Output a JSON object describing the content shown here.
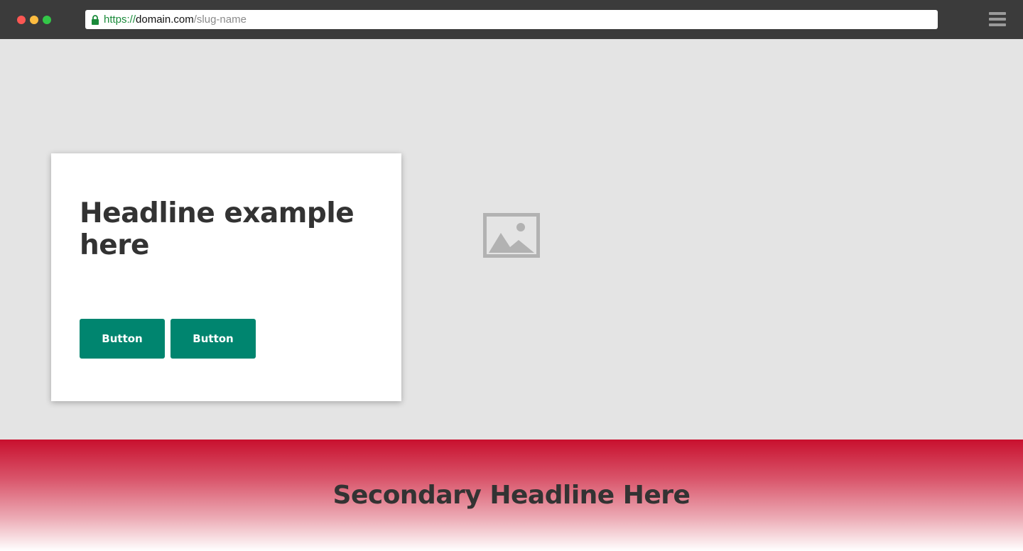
{
  "browser": {
    "window_controls": [
      "close",
      "minimize",
      "maximize"
    ],
    "url": {
      "scheme": "https://",
      "domain": "domain.com",
      "path": "/slug-name"
    },
    "icons": {
      "lock": "lock-icon",
      "menu": "hamburger-menu-icon"
    }
  },
  "hero": {
    "headline": "Headline example here",
    "buttons": [
      {
        "label": "Button"
      },
      {
        "label": "Button"
      }
    ],
    "image_icon": "image-placeholder-icon"
  },
  "secondary": {
    "headline": "Secondary Headline Here"
  },
  "colors": {
    "chrome": "#3b3b3b",
    "hero_background": "#e4e4e4",
    "button": "#00856f",
    "accent_red": "#c8102e",
    "text": "#333333",
    "url_green": "#1a8a3a"
  }
}
